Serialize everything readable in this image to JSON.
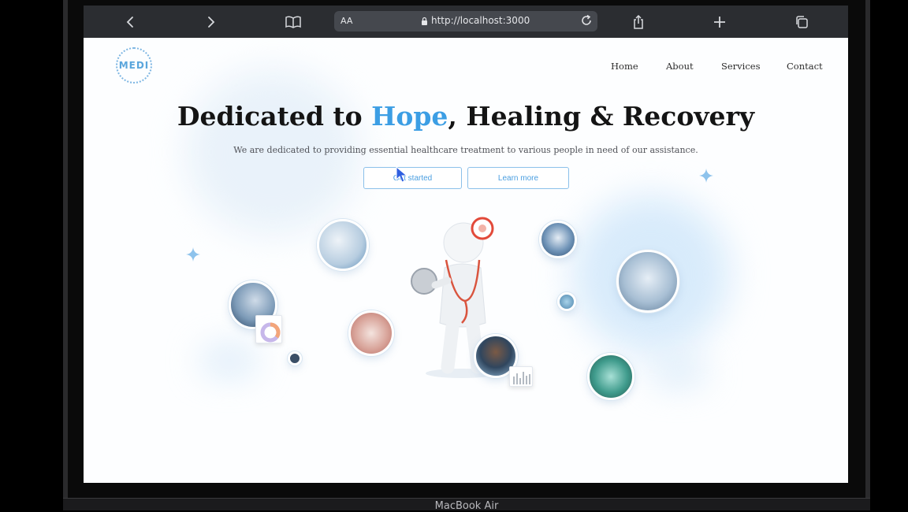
{
  "browser": {
    "reader_label": "AA",
    "url": "http://localhost:3000"
  },
  "device": {
    "label": "MacBook Air"
  },
  "site": {
    "logo_text": "MEDI",
    "nav": [
      "Home",
      "About",
      "Services",
      "Contact"
    ]
  },
  "hero": {
    "title_pre": "Dedicated to ",
    "title_highlight": "Hope",
    "title_post": ", Healing & Recovery",
    "subtitle": "We are dedicated to providing essential healthcare treatment to various people in need of our assistance.",
    "primary_cta": "Get started",
    "secondary_cta": "Learn more"
  },
  "colors": {
    "accent": "#3c9ee4",
    "toolbar": "#2b2d31",
    "page_bg": "#fdfeff"
  },
  "icons": [
    "back-icon",
    "forward-icon",
    "bookmarks-icon",
    "lock-icon",
    "reload-icon",
    "share-icon",
    "new-tab-icon",
    "tabs-icon",
    "cursor-icon",
    "sparkle-icon"
  ]
}
